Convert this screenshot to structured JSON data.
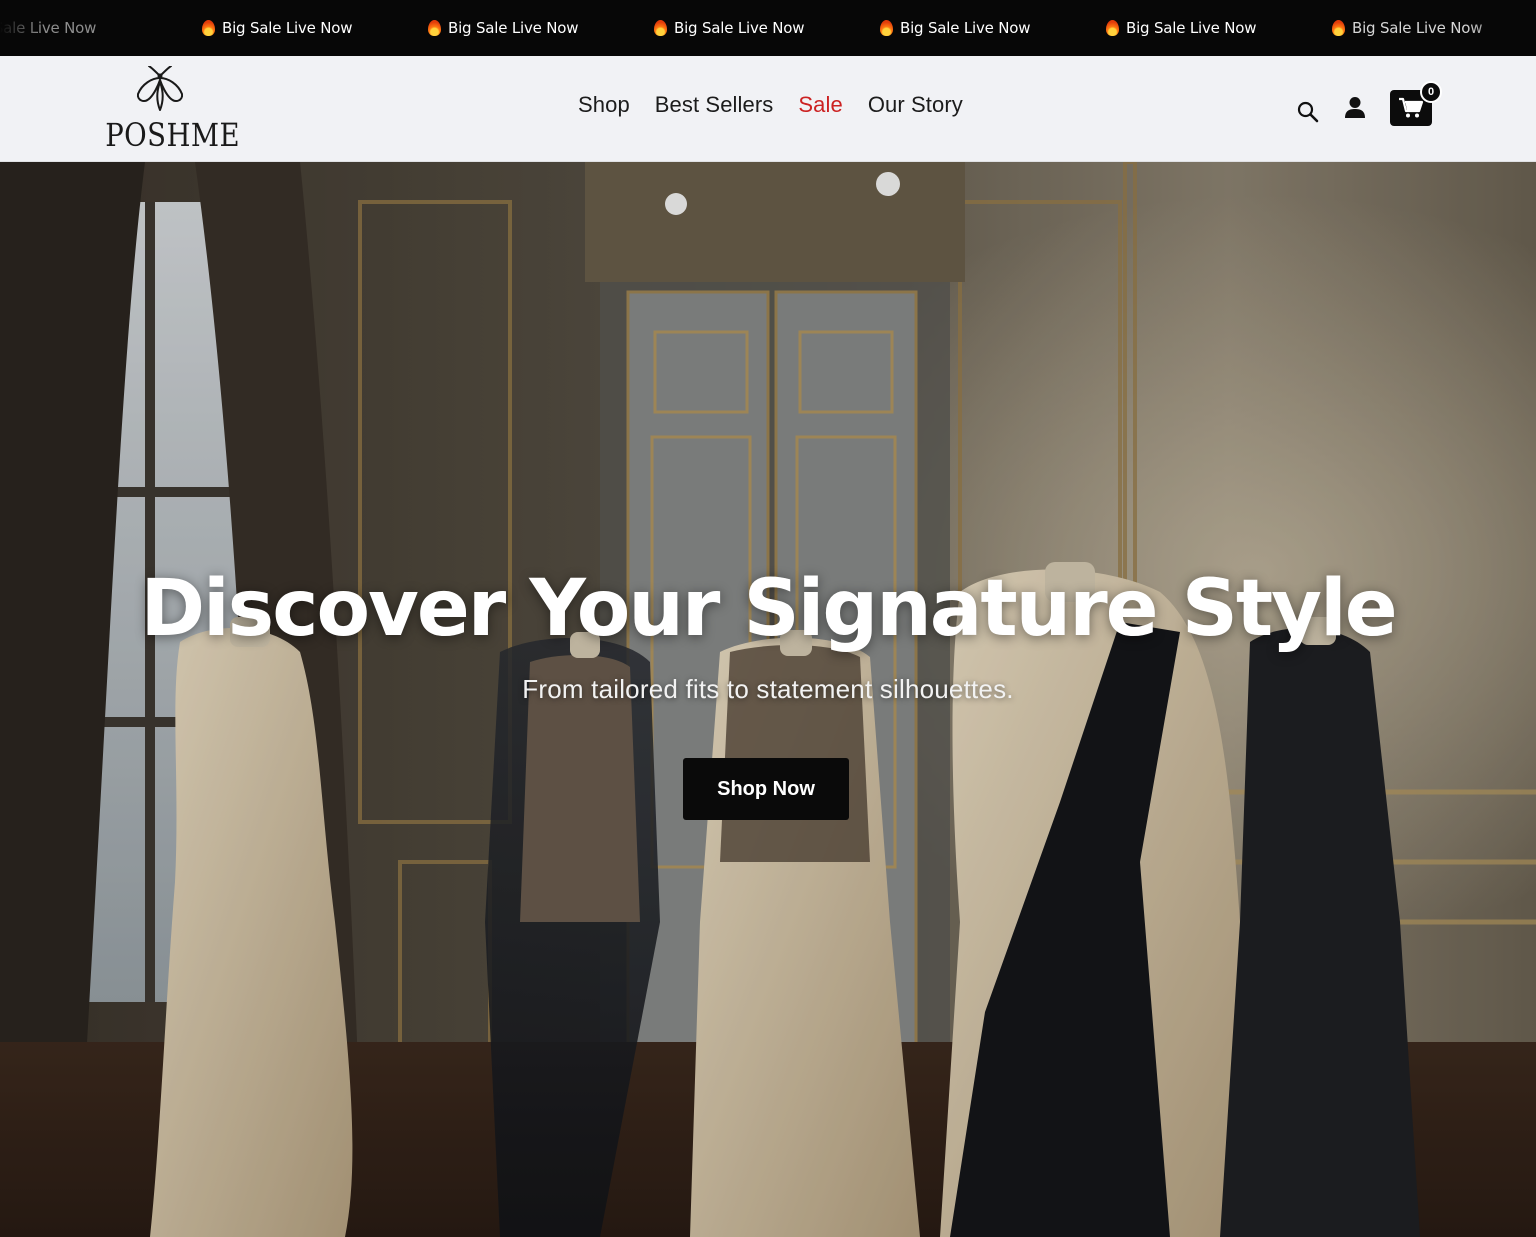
{
  "announcement": {
    "items": [
      "ig Sale Live Now",
      "Big Sale Live Now",
      "Big Sale Live Now",
      "Big Sale Live Now",
      "Big Sale Live Now",
      "Big Sale Live Now",
      "Big Sale Live Now"
    ],
    "icon": "fire-icon"
  },
  "header": {
    "logo_text": "POSHME",
    "nav": [
      {
        "label": "Shop"
      },
      {
        "label": "Best Sellers"
      },
      {
        "label": "Sale",
        "color": "#cc2222"
      },
      {
        "label": "Our Story"
      }
    ],
    "cart_count": "0"
  },
  "hero": {
    "title": "Discover Your Signature Style",
    "subtitle": "From tailored fits to statement silhouettes.",
    "cta_label": "Shop Now"
  },
  "colors": {
    "topbar_bg": "#070707",
    "header_bg": "#f1f2f5",
    "sale_red": "#cc2222",
    "button_bg": "#0a0a0a"
  }
}
